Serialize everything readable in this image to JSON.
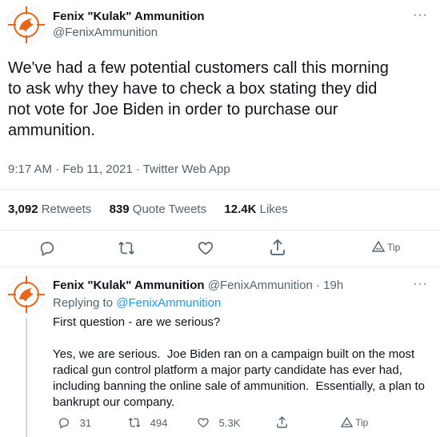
{
  "tweet": {
    "author_name": "Fenix \"Kulak\" Ammunition",
    "author_handle": "@FenixAmmunition",
    "more": "···",
    "text_lines": [
      "We've had a few potential customers call this morning",
      "to ask why they have to check a box stating they did",
      "not vote for Joe Biden in order to purchase our",
      "ammunition."
    ],
    "time": "9:17 AM",
    "date": "Feb 11, 2021",
    "source": "Twitter Web App",
    "sep": "·",
    "stats": {
      "retweets_count": "3,092",
      "retweets_label": "Retweets",
      "quotes_count": "839",
      "quotes_label": "Quote Tweets",
      "likes_count": "12.4K",
      "likes_label": "Likes"
    },
    "actions": {
      "tip_label": "Tip"
    },
    "icons": [
      "reply-icon",
      "retweet-icon",
      "like-icon",
      "share-icon",
      "tip-icon"
    ]
  },
  "reply": {
    "author_name": "Fenix \"Kulak\" Ammunition",
    "author_handle": "@FenixAmmunition",
    "age": "19h",
    "sep": "·",
    "more": "···",
    "replying_prefix": "Replying to",
    "replying_handle": "@FenixAmmunition",
    "question": "First question - are we serious?",
    "body_lines": [
      "Yes, we are serious.  Joe Biden ran on a campaign built on the most",
      "radical gun control platform a major party candidate has ever had,",
      "including banning the online sale of ammunition.  Essentially, a plan to",
      "bankrupt our company."
    ],
    "actions": {
      "replies": "31",
      "retweets": "494",
      "likes": "5.3K",
      "tip_label": "Tip"
    }
  },
  "colors": {
    "accent": "#1d9bf0",
    "secondary_text": "#536471",
    "avatar_orange": "#e8661a",
    "divider": "#e6ecf0"
  }
}
